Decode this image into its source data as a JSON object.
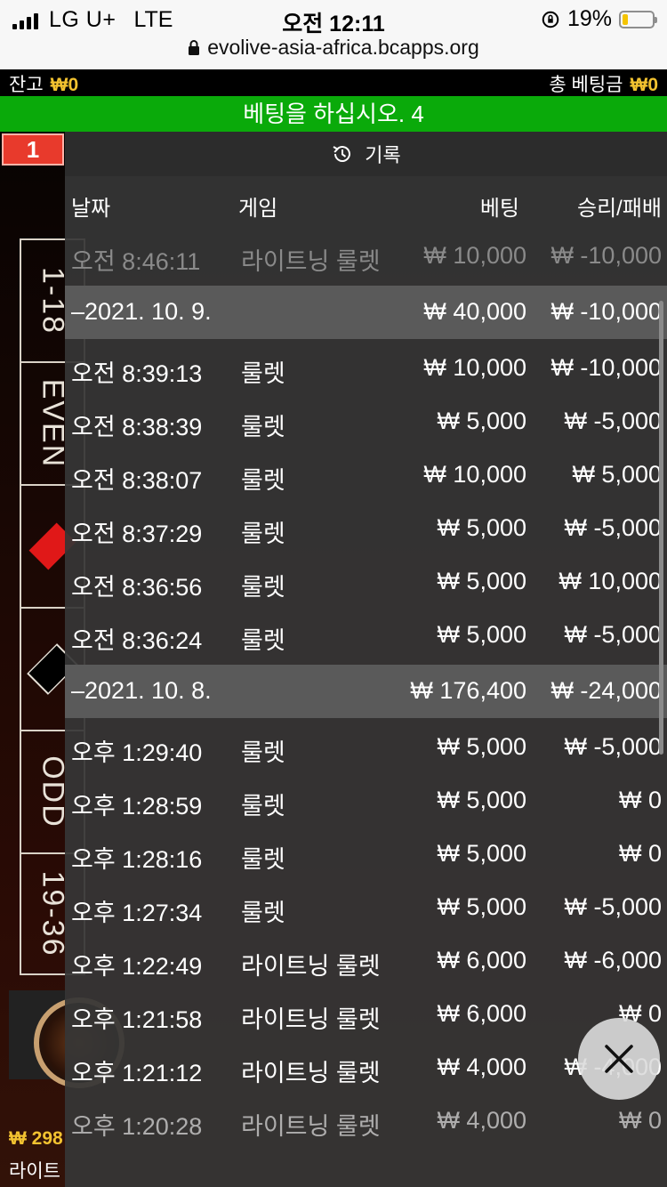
{
  "status_bar": {
    "carrier": "LG U+",
    "network": "LTE",
    "time": "오전 12:11",
    "battery": "19%",
    "battery_level": 0.19,
    "url": "evolive-asia-africa.bcapps.org"
  },
  "balance_bar": {
    "balance_label": "잔고",
    "balance_value": "₩0",
    "total_bet_label": "총 베팅금",
    "total_bet_value": "₩0"
  },
  "banner": "베팅을 하십시오. 4",
  "game_bg": {
    "badge": "1",
    "bet_cells": [
      "1-18",
      "EVEN",
      "ODD",
      "19-36"
    ],
    "bottom_balance": "₩ 298",
    "bottom_game": "라이트"
  },
  "history": {
    "title": "기록",
    "columns": {
      "date": "날짜",
      "game": "게임",
      "bet": "베팅",
      "win": "승리/패배"
    },
    "rows": [
      {
        "time": "오전 8:46:11",
        "game": "라이트닝 룰렛",
        "bet": "₩ 10,000",
        "win": "₩ -10,000",
        "style": "faded"
      },
      {
        "time": "–2021. 10. 9.",
        "game": "",
        "bet": "₩ 40,000",
        "win": "₩ -10,000",
        "style": "group"
      },
      {
        "time": "오전 8:39:13",
        "game": "룰렛",
        "bet": "₩ 10,000",
        "win": "₩ -10,000",
        "style": ""
      },
      {
        "time": "오전 8:38:39",
        "game": "룰렛",
        "bet": "₩ 5,000",
        "win": "₩ -5,000",
        "style": ""
      },
      {
        "time": "오전 8:38:07",
        "game": "룰렛",
        "bet": "₩ 10,000",
        "win": "₩ 5,000",
        "style": ""
      },
      {
        "time": "오전 8:37:29",
        "game": "룰렛",
        "bet": "₩ 5,000",
        "win": "₩ -5,000",
        "style": ""
      },
      {
        "time": "오전 8:36:56",
        "game": "룰렛",
        "bet": "₩ 5,000",
        "win": "₩ 10,000",
        "style": ""
      },
      {
        "time": "오전 8:36:24",
        "game": "룰렛",
        "bet": "₩ 5,000",
        "win": "₩ -5,000",
        "style": ""
      },
      {
        "time": "–2021. 10. 8.",
        "game": "",
        "bet": "₩ 176,400",
        "win": "₩ -24,000",
        "style": "group"
      },
      {
        "time": "오후 1:29:40",
        "game": "룰렛",
        "bet": "₩ 5,000",
        "win": "₩ -5,000",
        "style": ""
      },
      {
        "time": "오후 1:28:59",
        "game": "룰렛",
        "bet": "₩ 5,000",
        "win": "₩ 0",
        "style": ""
      },
      {
        "time": "오후 1:28:16",
        "game": "룰렛",
        "bet": "₩ 5,000",
        "win": "₩ 0",
        "style": ""
      },
      {
        "time": "오후 1:27:34",
        "game": "룰렛",
        "bet": "₩ 5,000",
        "win": "₩ -5,000",
        "style": ""
      },
      {
        "time": "오후 1:22:49",
        "game": "라이트닝 룰렛",
        "bet": "₩ 6,000",
        "win": "₩ -6,000",
        "style": ""
      },
      {
        "time": "오후 1:21:58",
        "game": "라이트닝 룰렛",
        "bet": "₩ 6,000",
        "win": "₩ 0",
        "style": ""
      },
      {
        "time": "오후 1:21:12",
        "game": "라이트닝 룰렛",
        "bet": "₩ 4,000",
        "win": "₩ -4,000",
        "style": ""
      },
      {
        "time": "오후 1:20:28",
        "game": "라이트닝 룰렛",
        "bet": "₩ 4,000",
        "win": "₩ 0",
        "style": "dim"
      }
    ]
  },
  "icons": {
    "lock": "lock-icon",
    "clock": "history-clock-icon",
    "close": "close-icon",
    "rotation_lock": "rotation-lock-icon"
  },
  "colors": {
    "banner_green": "#0aaa0a",
    "gold": "#f2c230",
    "badge_red": "#e83a2c",
    "battery_yellow": "#f5c400"
  }
}
